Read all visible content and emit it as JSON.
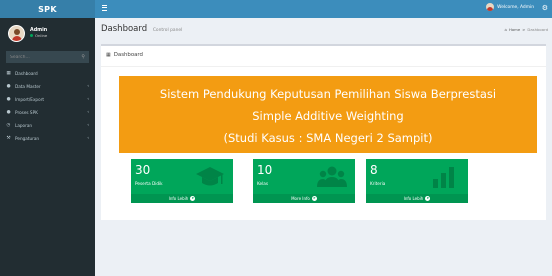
{
  "app": {
    "logo": "SPK"
  },
  "user": {
    "name": "Admin",
    "status": "Online",
    "top_label": "Welcome, Admin"
  },
  "sidebar": {
    "search_placeholder": "Search...",
    "items": [
      {
        "label": "Dashboard",
        "icon": "dashboard-icon",
        "has_children": false
      },
      {
        "label": "Data Master",
        "icon": "users-icon",
        "has_children": true
      },
      {
        "label": "Import/Export",
        "icon": "users-icon",
        "has_children": true
      },
      {
        "label": "Proses SPK",
        "icon": "users-icon",
        "has_children": true
      },
      {
        "label": "Laporan",
        "icon": "clock-icon",
        "has_children": true
      },
      {
        "label": "Pengaturan",
        "icon": "wrench-icon",
        "has_children": true
      }
    ]
  },
  "header": {
    "title": "Dashboard",
    "subtitle": "Control panel",
    "breadcrumb": {
      "home": "Home",
      "current": "Dashboard"
    }
  },
  "box": {
    "title": "Dashboard"
  },
  "banner": {
    "line1": "Sistem Pendukung Keputusan Pemilihan Siswa Berprestasi",
    "line2": "Simple Additive Weighting",
    "line3": "(Studi Kasus : SMA Negeri 2 Sampit)"
  },
  "tiles": [
    {
      "number": "30",
      "label": "Peserta Didik",
      "footer": "Info Lebih",
      "icon": "graduation-cap-icon"
    },
    {
      "number": "10",
      "label": "Kelas",
      "footer": "More Info",
      "icon": "group-icon"
    },
    {
      "number": "8",
      "label": "Kriteria",
      "footer": "Info Lebih",
      "icon": "bar-chart-icon"
    }
  ],
  "colors": {
    "sidebar": "#222d32",
    "topbar": "#3c8dbc",
    "logo": "#367fa9",
    "banner": "#f39c12",
    "tile": "#00a65a",
    "tile_footer": "#009551"
  }
}
